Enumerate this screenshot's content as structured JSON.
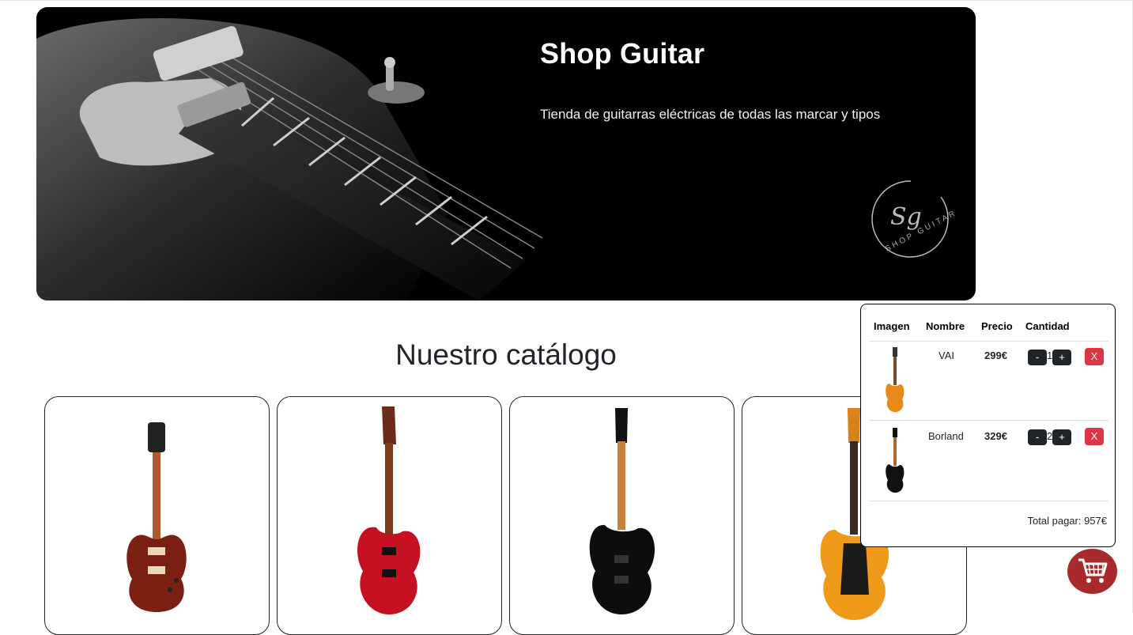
{
  "hero": {
    "title": "Shop Guitar",
    "subtitle": "Tienda de guitarras eléctricas de todas las marcar y tipos",
    "logo_initials": "Sg",
    "logo_text": "SHOP GUITAR"
  },
  "catalog": {
    "title": "Nuestro catálogo",
    "products": [
      {
        "body_color": "#7a1f12",
        "icon": "les-paul-guitar-icon"
      },
      {
        "body_color": "#c41020",
        "icon": "red-superstrat-guitar-icon"
      },
      {
        "body_color": "#0d0d0d",
        "icon": "black-superstrat-guitar-icon"
      },
      {
        "body_color": "#f09a1c",
        "icon": "orange-superstrat-guitar-icon"
      }
    ]
  },
  "cart": {
    "headers": {
      "image": "Imagen",
      "name": "Nombre",
      "price": "Precio",
      "quantity": "Cantidad"
    },
    "items": [
      {
        "name": "VAI",
        "price": "299€",
        "quantity": "1",
        "minus": "-",
        "plus": "+",
        "remove": "X",
        "body_color": "#e8891a"
      },
      {
        "name": "Borland",
        "price": "329€",
        "quantity": "2",
        "minus": "-",
        "plus": "+",
        "remove": "X",
        "body_color": "#111111"
      }
    ],
    "total": "Total pagar: 957€",
    "icon": "shopping-cart-icon",
    "accent": "#a82a2a"
  }
}
